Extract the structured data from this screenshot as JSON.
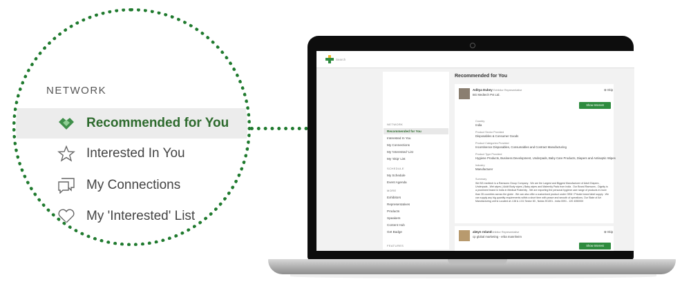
{
  "zoom": {
    "section": "NETWORK",
    "items": [
      {
        "label": "Recommended for You",
        "icon": "handshake-icon"
      },
      {
        "label": "Interested In You",
        "icon": "star-icon"
      },
      {
        "label": "My Connections",
        "icon": "chat-bubbles-icon"
      },
      {
        "label": "My 'Interested' List",
        "icon": "heart-icon"
      }
    ]
  },
  "app": {
    "search_placeholder": "Search",
    "sidebar": {
      "network_label": "NETWORK",
      "network_items": [
        "Recommended for You",
        "Interested In You",
        "My Connections",
        "My 'Interested' List",
        "My 'Skip' List"
      ],
      "schedule_label": "SCHEDULE",
      "schedule_items": [
        "My Schedule",
        "Event Agenda"
      ],
      "more_label": "MORE",
      "more_items": [
        "Exhibitors",
        "Representatives",
        "Products",
        "Speakers",
        "Content Hub",
        "Get Badge"
      ],
      "features_label": "FEATURES"
    },
    "page_title": "Recommended for You",
    "cards": [
      {
        "name": "Aditya Dubey",
        "role": "Exhibitor Representative",
        "company": "BG Medtech Pvt Ltd.",
        "skip": "Skip",
        "button": "Show Interest",
        "fields": [
          {
            "label": "Country",
            "value": "India"
          },
          {
            "label": "Product Sector Provided",
            "value": "Disposables & Consumer Goods"
          },
          {
            "label": "Product Categories Provided",
            "value": "Incontinence Disposables, Consumables and Contract Manufacturing"
          },
          {
            "label": "Product Type Provided",
            "value": "Hygiene Products, Business Development, Underpads, Baby Care Products, Diapers and Antiseptic Wipes"
          },
          {
            "label": "Industry",
            "value": "Manufacturer"
          }
        ],
        "summary_label": "Summary",
        "summary": "We BG medtech is a Ramsons Group Company . We are the Largest and Biggest Manufacturer of Adult Diapers , Underpads , Wet wipes ( Adult Body wipes ) Baby wipes and Maternity Pads from India . Our Brand Ramsons - Dignity is a prominent brand in India in Medical Fraternity . We are exporting the personal hygiene care range of products in more than 35 countries across the globe . We can also offer a customised product under OEM / Private brand label supply . We can supply any big quantity requirements within a short time with peace and smooth of operations. Our State of Art Manufacturing unit is Located at J-38 & J-51 Sector 83 , Noida 201301 - India 0091 - 120 4350000"
      },
      {
        "name": "alwyn roland",
        "role": "Exhibitor Representative",
        "company": "cp global marketing - erba mannheim",
        "skip": "Skip",
        "button": "Show Interest"
      }
    ]
  },
  "colors": {
    "accent": "#1f7a2e",
    "button": "#2e8b3e"
  }
}
